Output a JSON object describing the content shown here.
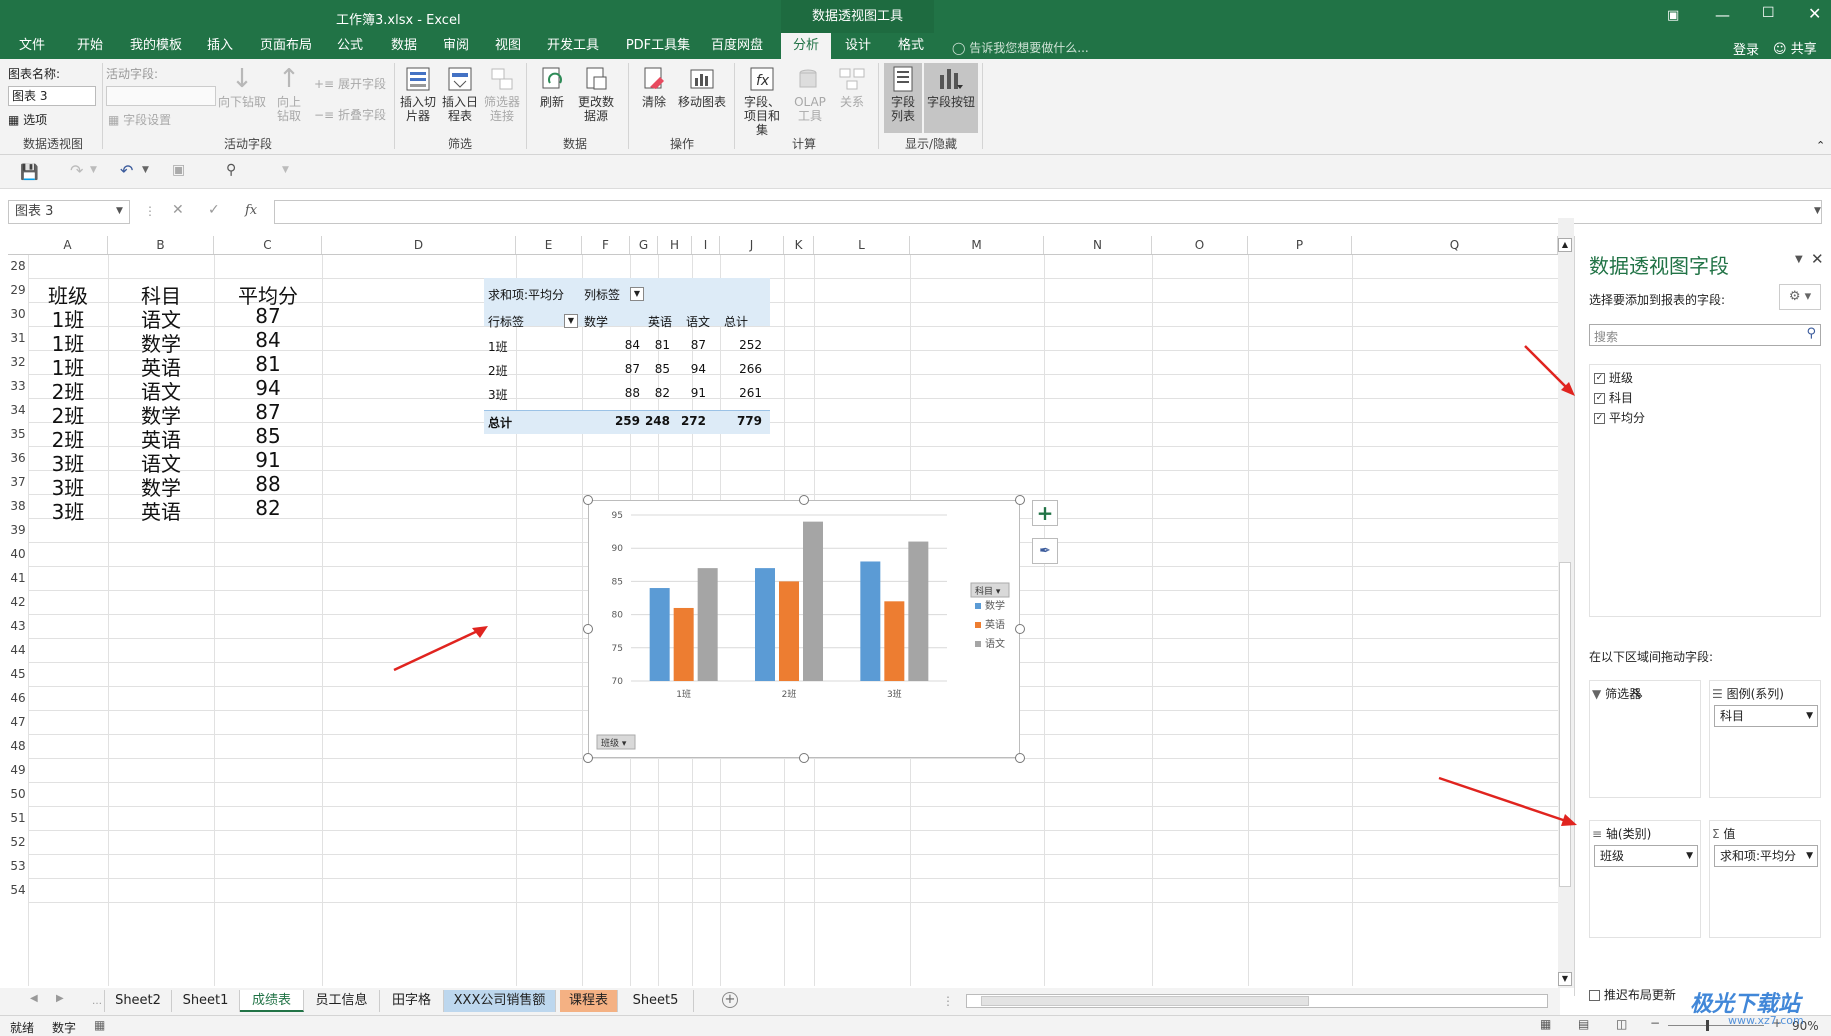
{
  "window": {
    "title": "工作簿3.xlsx  -  Excel",
    "context_tab": "数据透视图工具",
    "login": "登录",
    "share": "共享"
  },
  "tabs": [
    "文件",
    "开始",
    "我的模板",
    "插入",
    "页面布局",
    "公式",
    "数据",
    "审阅",
    "视图",
    "开发工具",
    "PDF工具集",
    "百度网盘",
    "分析",
    "设计",
    "格式"
  ],
  "tell_me": "告诉我您想要做什么...",
  "ribbon": {
    "chart_name_label": "图表名称:",
    "chart_name_value": "图表 3",
    "options": "选项",
    "group_pivotchart": "数据透视图",
    "active_field_label": "活动字段:",
    "field_settings": "字段设置",
    "drill_down": "向下钻取",
    "drill_up": "向上钻取",
    "expand_field": "展开字段",
    "collapse_field": "折叠字段",
    "group_active_field": "活动字段",
    "insert_slicer": "插入切片器",
    "insert_timeline": "插入日程表",
    "filter_connections": "筛选器连接",
    "group_filter": "筛选",
    "refresh": "刷新",
    "change_source": "更改数据源",
    "group_data": "数据",
    "clear": "清除",
    "move_chart": "移动图表",
    "group_actions": "操作",
    "fields_items": "字段、项目和集",
    "olap_tools": "OLAP工具",
    "relationships": "关系",
    "group_calc": "计算",
    "field_list": "字段列表",
    "field_buttons": "字段按钮",
    "group_show": "显示/隐藏"
  },
  "formula_bar": {
    "name_box": "图表 3",
    "fx": "fx"
  },
  "columns": [
    "A",
    "B",
    "C",
    "D",
    "E",
    "F",
    "G",
    "H",
    "I",
    "J",
    "K",
    "L",
    "M",
    "N",
    "O",
    "P",
    "Q"
  ],
  "rows": [
    "28",
    "29",
    "30",
    "31",
    "32",
    "33",
    "34",
    "35",
    "36",
    "37",
    "38",
    "39",
    "40",
    "41",
    "42",
    "43",
    "44",
    "45",
    "46",
    "47",
    "48",
    "49",
    "50",
    "51",
    "52",
    "53",
    "54"
  ],
  "table": {
    "headers": [
      "班级",
      "科目",
      "平均分"
    ],
    "rows": [
      [
        "1班",
        "语文",
        "87"
      ],
      [
        "1班",
        "数学",
        "84"
      ],
      [
        "1班",
        "英语",
        "81"
      ],
      [
        "2班",
        "语文",
        "94"
      ],
      [
        "2班",
        "数学",
        "87"
      ],
      [
        "2班",
        "英语",
        "85"
      ],
      [
        "3班",
        "语文",
        "91"
      ],
      [
        "3班",
        "数学",
        "88"
      ],
      [
        "3班",
        "英语",
        "82"
      ]
    ]
  },
  "pivot": {
    "title": "求和项:平均分",
    "col_label": "列标签",
    "row_label": "行标签",
    "cols": [
      "数学",
      "英语",
      "语文",
      "总计"
    ],
    "rows": [
      {
        "label": "1班",
        "values": [
          "84",
          "81",
          "87",
          "252"
        ]
      },
      {
        "label": "2班",
        "values": [
          "87",
          "85",
          "94",
          "266"
        ]
      },
      {
        "label": "3班",
        "values": [
          "88",
          "82",
          "91",
          "261"
        ]
      }
    ],
    "total": {
      "label": "总计",
      "values": [
        "259",
        "248",
        "272",
        "779"
      ]
    }
  },
  "chart_data": {
    "type": "bar",
    "categories": [
      "1班",
      "2班",
      "3班"
    ],
    "series": [
      {
        "name": "数学",
        "values": [
          84,
          87,
          88
        ],
        "color": "#5b9bd5"
      },
      {
        "name": "英语",
        "values": [
          81,
          85,
          82
        ],
        "color": "#ed7d31"
      },
      {
        "name": "语文",
        "values": [
          87,
          94,
          91
        ],
        "color": "#a5a5a5"
      }
    ],
    "yticks": [
      "95",
      "90",
      "85",
      "80",
      "75",
      "70"
    ],
    "ylim": [
      70,
      95
    ],
    "legend_button": "科目",
    "axis_button": "班级",
    "legend_position": "right"
  },
  "pane": {
    "title": "数据透视图字段",
    "subtitle": "选择要添加到报表的字段:",
    "search_placeholder": "搜索",
    "fields": [
      "班级",
      "科目",
      "平均分"
    ],
    "drag_label": "在以下区域间拖动字段:",
    "filters": "筛选器",
    "legend": "图例(系列)",
    "legend_value": "科目",
    "axis": "轴(类别)",
    "axis_value": "班级",
    "values": "值",
    "values_value": "求和项:平均分",
    "defer": "推迟布局更新"
  },
  "sheet_tabs": [
    "Sheet2",
    "Sheet1",
    "成绩表",
    "员工信息",
    "田字格",
    "XXX公司销售额",
    "课程表",
    "Sheet5"
  ],
  "status": {
    "ready": "就绪",
    "num": "数字",
    "zoom": "90%"
  },
  "watermark": "极光下载站",
  "watermark_url": "www.xz7.com"
}
